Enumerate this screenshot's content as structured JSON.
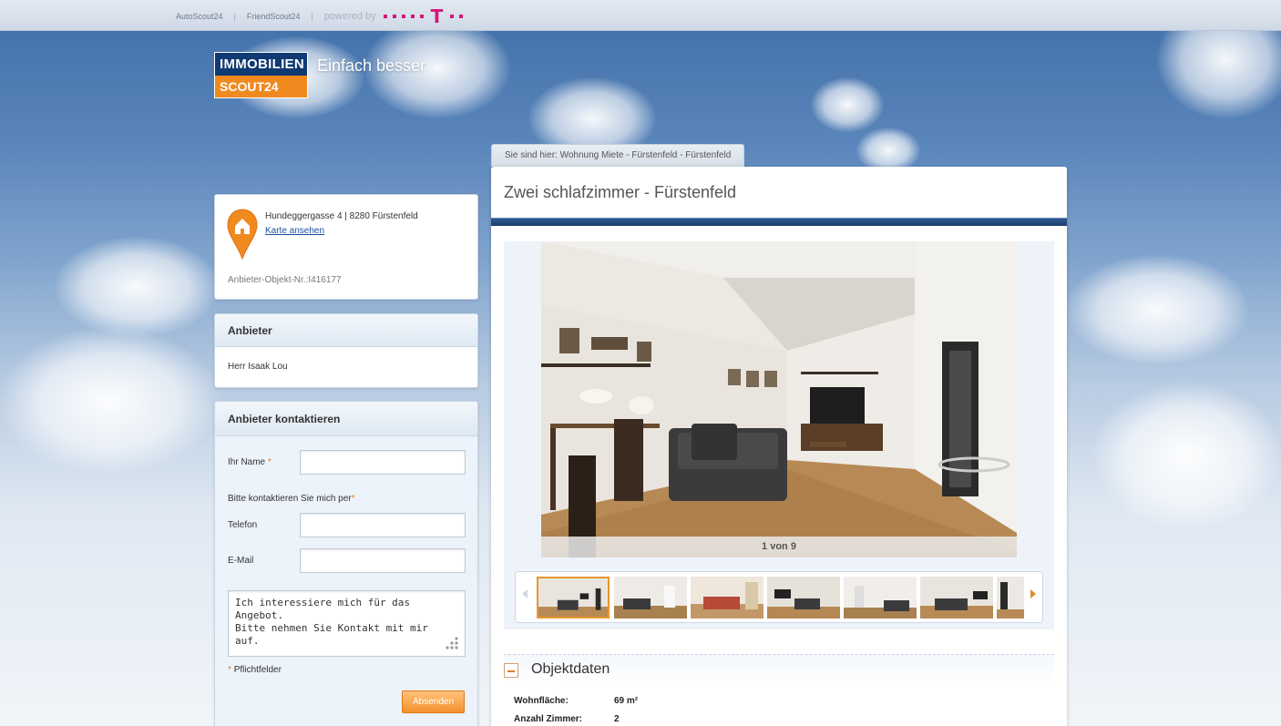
{
  "topbar": {
    "links": [
      "AutoScout24",
      "FriendScout24"
    ],
    "powered_by": "powered by"
  },
  "brand": {
    "logo_top": "IMMOBILIEN",
    "logo_bottom": "SCOUT24",
    "slogan": "Einfach besser",
    "colors": {
      "navy": "#0f3a72",
      "orange": "#f08a1f",
      "telekom": "#d4157a"
    }
  },
  "breadcrumb": "Sie sind hier: Wohnung Miete - Fürstenfeld - Fürstenfeld",
  "location": {
    "address": "Hundeggergasse 4 | 8280 Fürstenfeld",
    "map_link": "Karte ansehen",
    "object_nr": "Anbieter-Objekt-Nr.:I416177",
    "icon": "map-pin-house-icon"
  },
  "provider": {
    "heading": "Anbieter",
    "name": "Herr Isaak Lou"
  },
  "contact": {
    "heading": "Anbieter kontaktieren",
    "name_label": "Ihr Name",
    "contact_by_label": "Bitte kontaktieren Sie mich per",
    "phone_label": "Telefon",
    "email_label": "E-Mail",
    "message": "Ich interessiere mich für das Angebot.\nBitte nehmen Sie Kontakt mit mir auf.",
    "required_note": "Pflichtfelder",
    "required_mark": "*",
    "submit": "Absenden"
  },
  "listing": {
    "title": "Zwei schlafzimmer - Fürstenfeld",
    "counter": "1 von 9",
    "thumbnail_count": 7,
    "objekt_heading": "Objektdaten",
    "details": [
      {
        "key": "Wohnfläche:",
        "value": "69 m²"
      },
      {
        "key": "Anzahl Zimmer:",
        "value": "2"
      }
    ]
  }
}
